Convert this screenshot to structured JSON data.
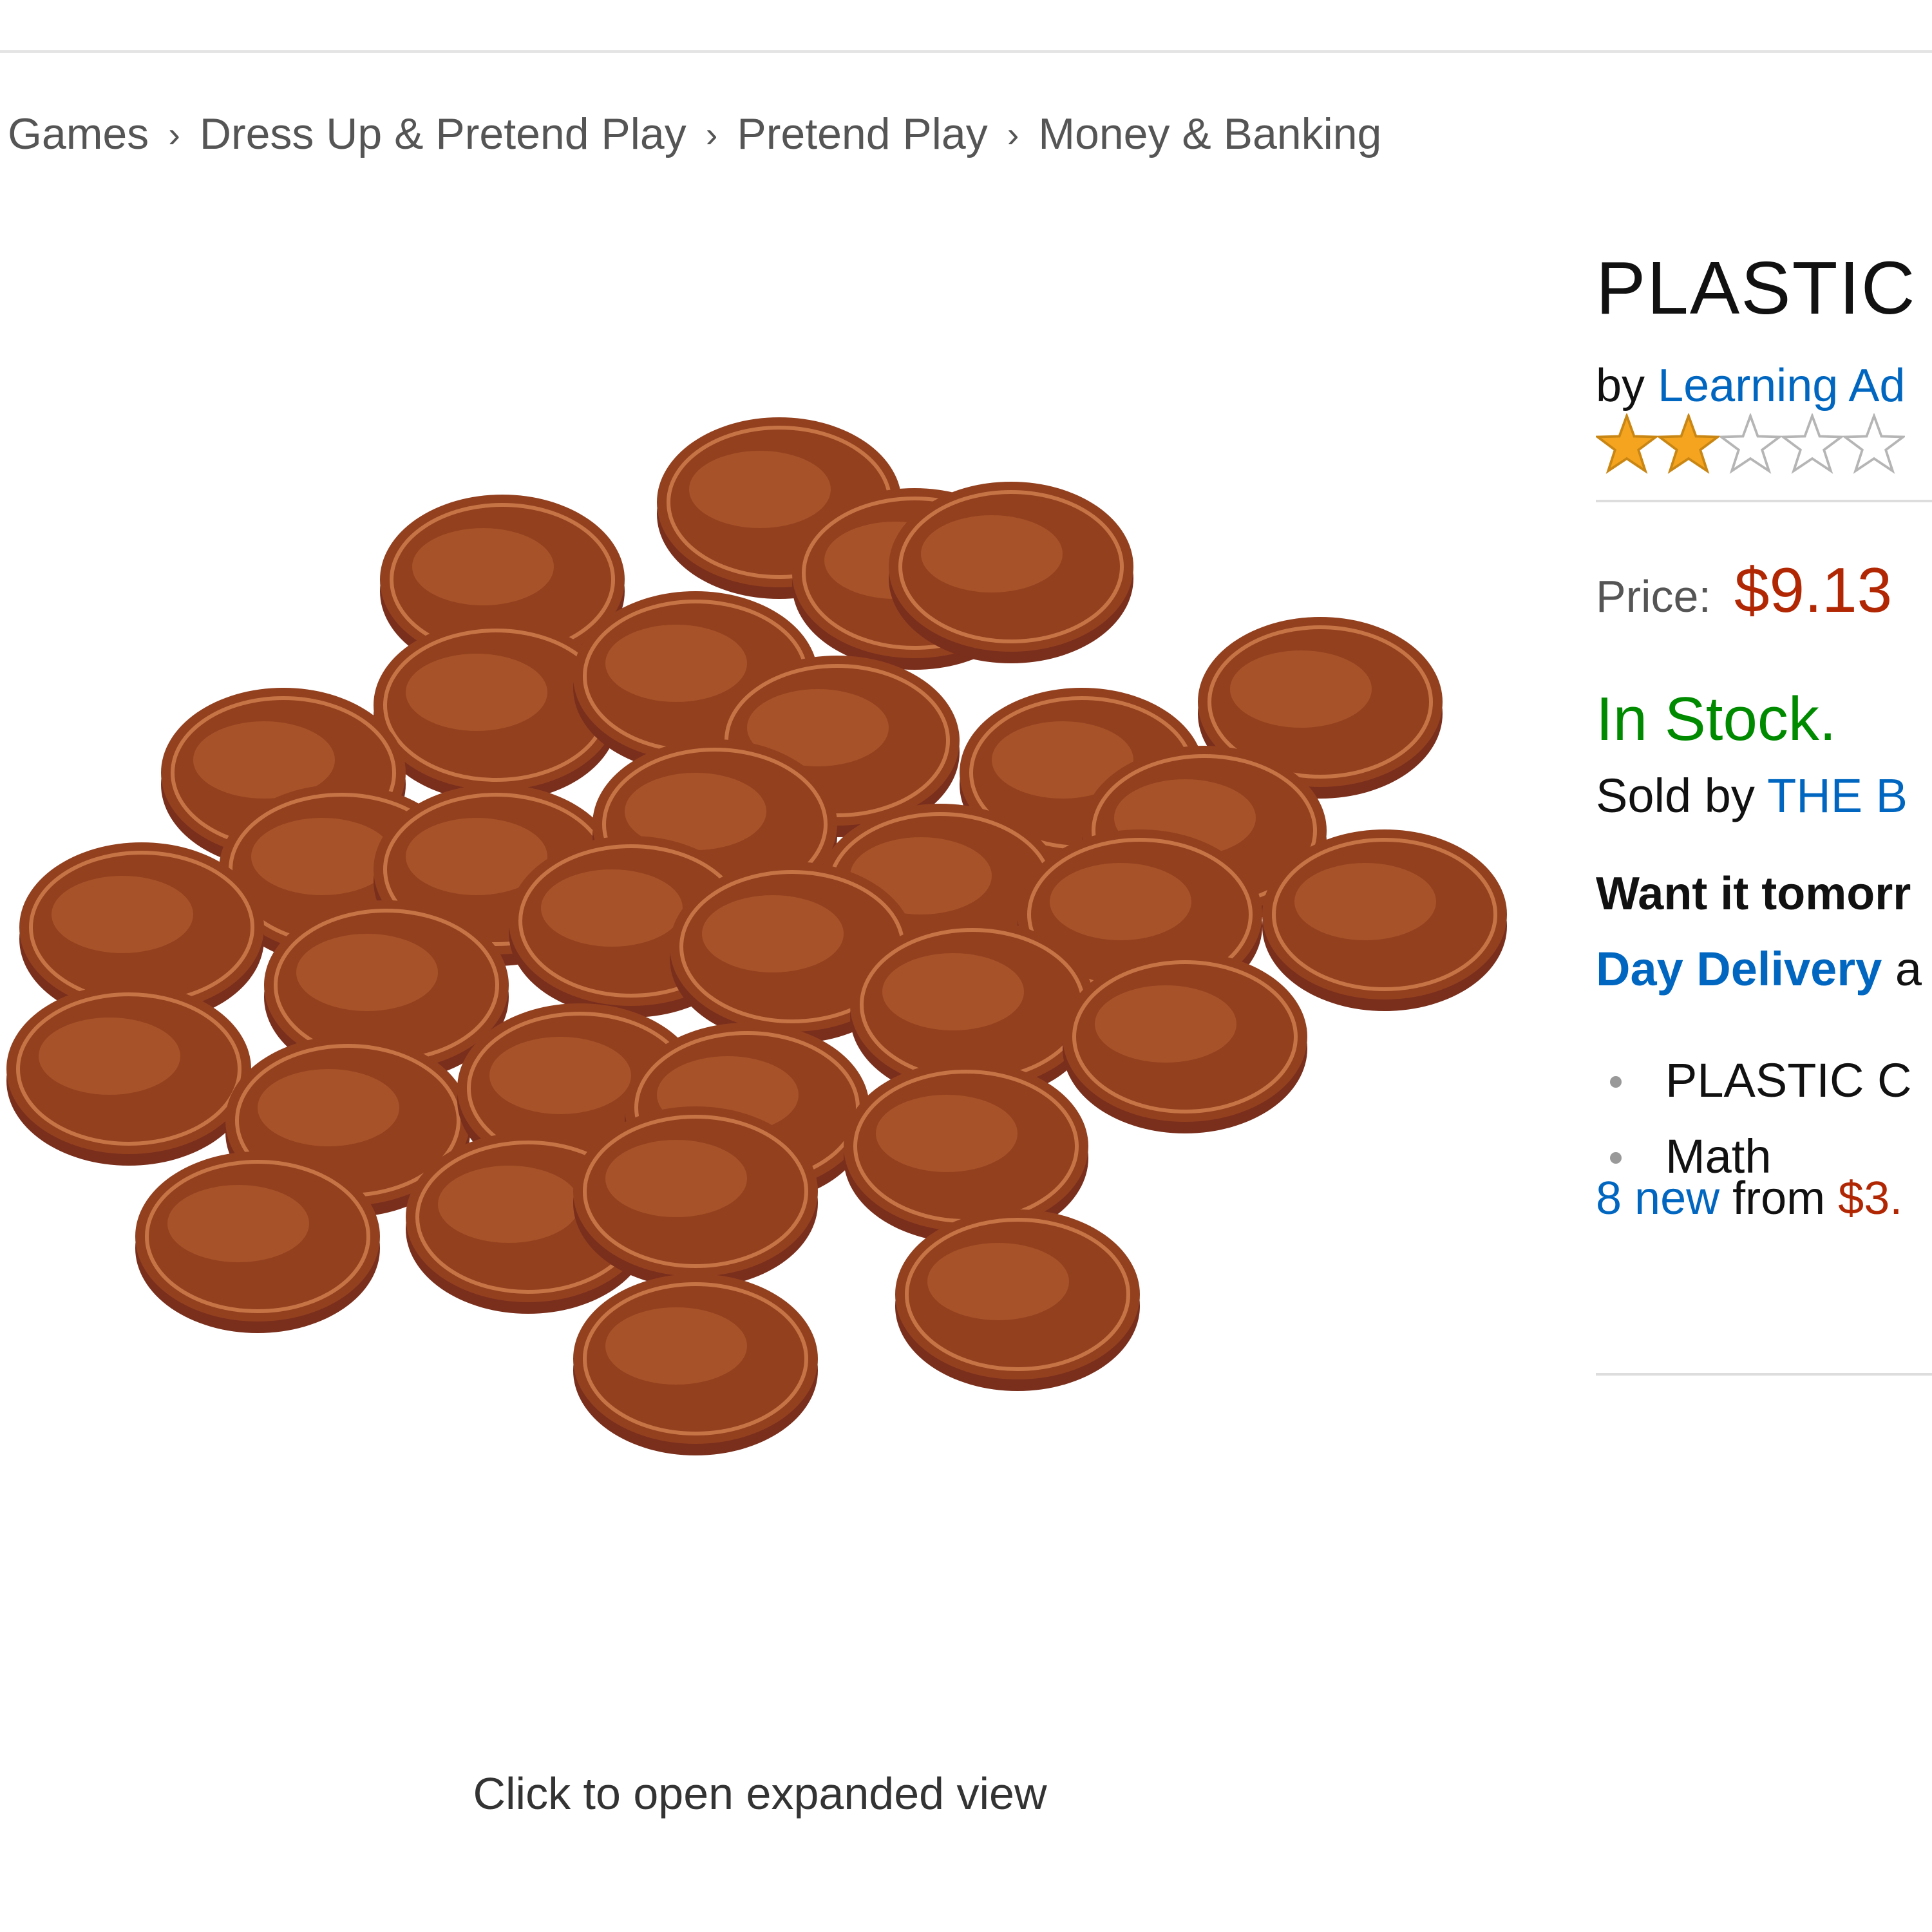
{
  "breadcrumb": [
    "Games",
    "Dress Up & Pretend Play",
    "Pretend Play",
    "Money & Banking"
  ],
  "breadcrumb_separator": "›",
  "image": {
    "caption": "Click to open expanded view"
  },
  "product": {
    "title": "PLASTIC",
    "by_prefix": "by",
    "brand": "Learning Ad",
    "rating": {
      "filled": 2,
      "total": 5
    },
    "price_label": "Price:",
    "price": "$9.13",
    "stock": "In Stock.",
    "sold_by_prefix": "Sold by",
    "seller": "THE B",
    "delivery_want": "Want it tomorr",
    "delivery_day": "Day Delivery",
    "delivery_day_rest": "a",
    "bullets": [
      "PLASTIC C",
      "Math"
    ],
    "offers_new": "8 new",
    "offers_from": "from",
    "offers_price": "$3."
  },
  "colors": {
    "link": "#0066c0",
    "price": "#b12704",
    "in_stock": "#008a00",
    "star_fill": "#f4a41e",
    "coin": "#7a2e1c"
  }
}
